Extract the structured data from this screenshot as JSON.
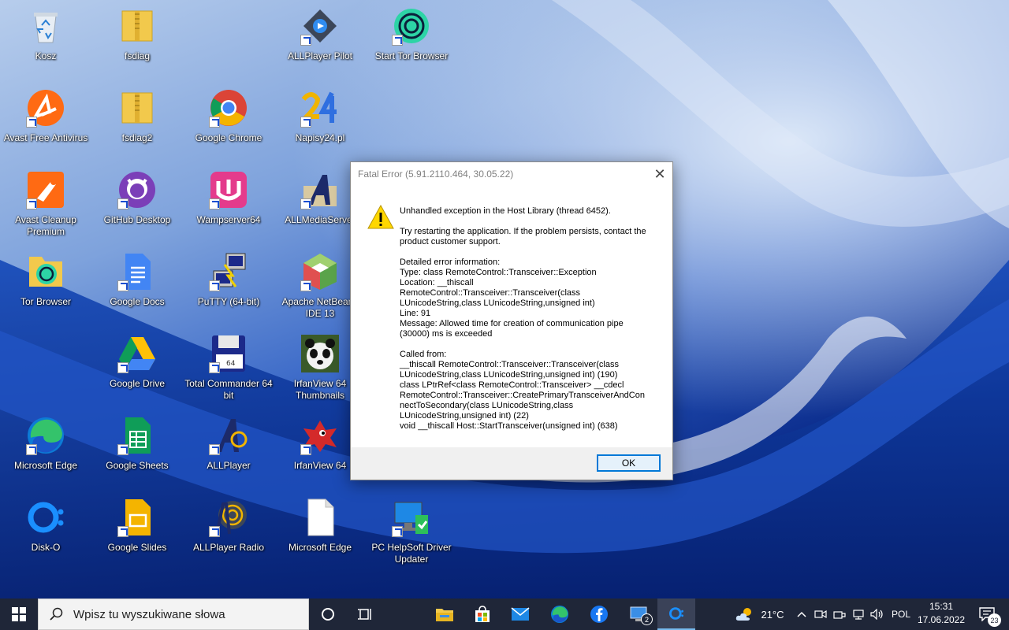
{
  "desktop": {
    "icons": [
      {
        "label": "Kosz",
        "icon": "recycle-bin-icon"
      },
      {
        "label": "fsdiag",
        "icon": "zip-folder-icon"
      },
      {
        "label": "ALLPlayer Pilot",
        "icon": "allplayer-pilot-icon"
      },
      {
        "label": "Start Tor Browser",
        "icon": "tor-browser-icon"
      },
      {
        "label": "Avast Free Antivirus",
        "icon": "avast-icon"
      },
      {
        "label": "fsdiag2",
        "icon": "zip-folder-icon"
      },
      {
        "label": "Google Chrome",
        "icon": "chrome-icon"
      },
      {
        "label": "Napisy24.pl",
        "icon": "napisy24-icon"
      },
      {
        "label": "Avast Cleanup Premium",
        "icon": "avast-cleanup-icon"
      },
      {
        "label": "GitHub Desktop",
        "icon": "github-desktop-icon"
      },
      {
        "label": "Wampserver64",
        "icon": "wampserver-icon"
      },
      {
        "label": "ALLMediaServer",
        "icon": "allmediaserver-icon"
      },
      {
        "label": "Tor Browser",
        "icon": "tor-browser-icon"
      },
      {
        "label": "Google Docs",
        "icon": "google-docs-icon"
      },
      {
        "label": "PuTTY (64-bit)",
        "icon": "putty-icon"
      },
      {
        "label": "Apache NetBeans IDE 13",
        "icon": "netbeans-icon"
      },
      {
        "label": "Google Drive",
        "icon": "google-drive-icon"
      },
      {
        "label": "Total Commander 64 bit",
        "icon": "total-commander-icon"
      },
      {
        "label": "IrfanView 64 Thumbnails",
        "icon": "irfanview-thumbnails-icon"
      },
      {
        "label": "Microsoft Edge",
        "icon": "edge-icon"
      },
      {
        "label": "Google Sheets",
        "icon": "google-sheets-icon"
      },
      {
        "label": "ALLPlayer",
        "icon": "allplayer-icon"
      },
      {
        "label": "IrfanView 64",
        "icon": "irfanview-icon"
      },
      {
        "label": "Disk-O",
        "icon": "disk-o-icon"
      },
      {
        "label": "Google Slides",
        "icon": "google-slides-icon"
      },
      {
        "label": "ALLPlayer Radio",
        "icon": "allplayer-radio-icon"
      },
      {
        "label": "Microsoft Edge",
        "icon": "blank-document-icon"
      },
      {
        "label": "PC HelpSoft Driver Updater",
        "icon": "driver-updater-icon"
      }
    ]
  },
  "dialog": {
    "title": "Fatal Error (5.91.2110.464, 30.05.22)",
    "close_glyph": "✕",
    "heading": "Unhandled exception in the Host Library (thread 6452).",
    "advice": "Try restarting the application. If the problem persists, contact the product customer support.",
    "details_lines": [
      "Detailed error information:",
      "Type: class RemoteControl::Transceiver::Exception",
      "Location: __thiscall",
      "RemoteControl::Transceiver::Transceiver(class",
      "LUnicodeString,class LUnicodeString,unsigned int)",
      "Line: 91",
      "Message: Allowed time for creation of communication pipe",
      "(30000) ms is exceeded"
    ],
    "called_from_lines": [
      "Called from:",
      "__thiscall RemoteControl::Transceiver::Transceiver(class",
      "LUnicodeString,class LUnicodeString,unsigned int) (190)",
      "class LPtrRef<class RemoteControl::Transceiver> __cdecl",
      "RemoteControl::Transceiver::CreatePrimaryTransceiverAndCon",
      "nectToSecondary(class LUnicodeString,class",
      "LUnicodeString,unsigned int) (22)",
      "void __thiscall Host::StartTransceiver(unsigned int) (638)"
    ],
    "ok_label": "OK"
  },
  "taskbar": {
    "search_placeholder": "Wpisz tu wyszukiwane słowa",
    "pinned_badge": "2",
    "weather_temp": "21°C",
    "language": "POL",
    "time": "15:31",
    "date": "17.06.2022",
    "notification_count": "23"
  },
  "colors": {
    "accent": "#0078d7",
    "taskbar_bg": "#1f2638",
    "warning_yellow": "#ffd700"
  }
}
